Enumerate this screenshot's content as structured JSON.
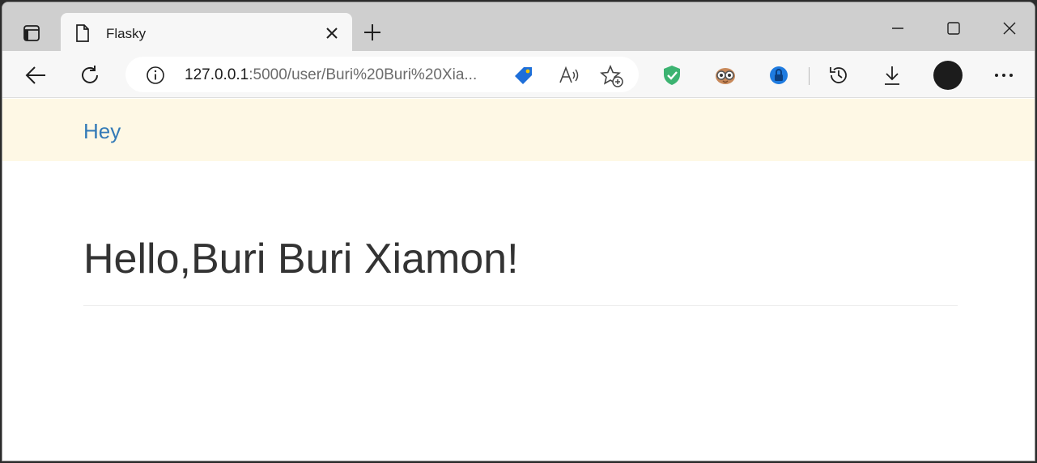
{
  "browser": {
    "tab": {
      "title": "Flasky"
    },
    "address": {
      "host": "127.0.0.1",
      "path": ":5000/user/Buri%20Buri%20Xia..."
    }
  },
  "page": {
    "navbar": {
      "brand": "Hey"
    },
    "heading": "Hello,Buri Buri Xiamon!"
  },
  "colors": {
    "navbar_bg": "#fef8e5",
    "brand_link": "#337ab7",
    "heading_text": "#333333"
  }
}
